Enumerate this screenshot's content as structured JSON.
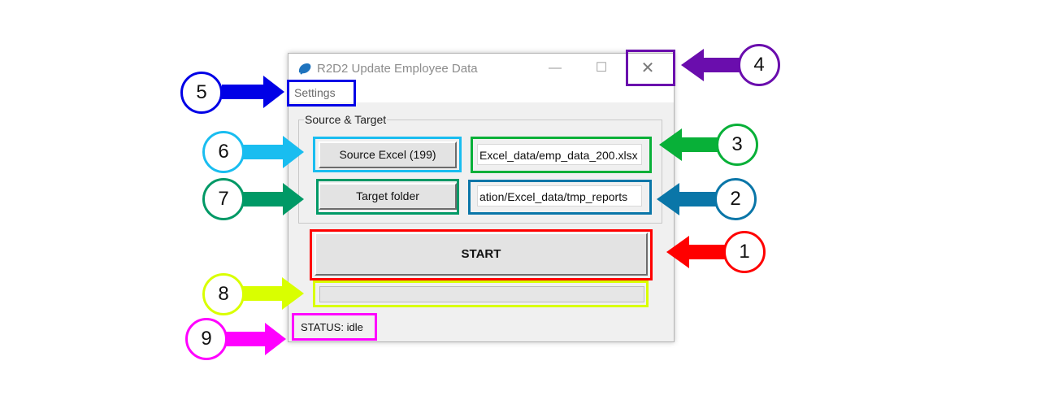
{
  "window": {
    "title": "R2D2 Update Employee Data",
    "min_glyph": "—",
    "max_glyph": "☐",
    "close_glyph": "✕"
  },
  "menu": {
    "settings": "Settings"
  },
  "group": {
    "title": "Source & Target"
  },
  "source": {
    "button_label": "Source Excel (199)",
    "path": "Excel_data/emp_data_200.xlsx"
  },
  "target": {
    "button_label": "Target folder",
    "path": "ation/Excel_data/tmp_reports"
  },
  "start": {
    "label": "START"
  },
  "progress": {
    "value": 0
  },
  "status": {
    "text": "STATUS: idle"
  },
  "annotations": [
    {
      "n": "1",
      "color": "#ff0000"
    },
    {
      "n": "2",
      "color": "#0a76a8"
    },
    {
      "n": "3",
      "color": "#08b038"
    },
    {
      "n": "4",
      "color": "#6a0dad"
    },
    {
      "n": "5",
      "color": "#0000e6"
    },
    {
      "n": "6",
      "color": "#19bdf0"
    },
    {
      "n": "7",
      "color": "#009966"
    },
    {
      "n": "8",
      "color": "#d9ff00"
    },
    {
      "n": "9",
      "color": "#ff00ff"
    }
  ],
  "colors": {
    "app_icon": "#1e73be",
    "progress_fill": "#06b025"
  }
}
